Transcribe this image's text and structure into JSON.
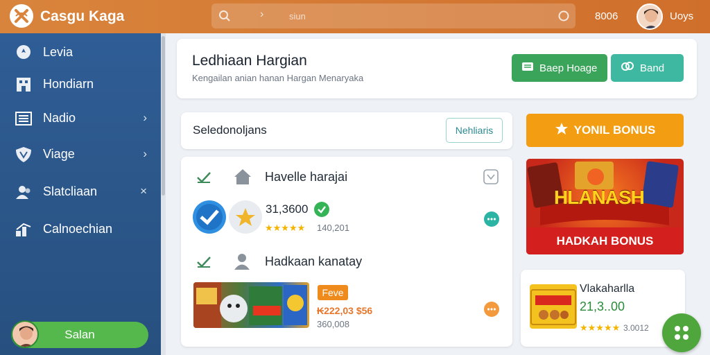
{
  "app": {
    "title": "Casgu Kaga"
  },
  "search": {
    "placeholder": "siun"
  },
  "topbar": {
    "count": "8006",
    "username": "Uoys"
  },
  "sidebar": {
    "items": [
      {
        "label": "Levia",
        "icon": "location-pin-icon",
        "chevron": false
      },
      {
        "label": "Hondiarn",
        "icon": "building-icon",
        "chevron": false
      },
      {
        "label": "Nadio",
        "icon": "list-icon",
        "chevron": true
      },
      {
        "label": "Viage",
        "icon": "shield-icon",
        "chevron": true
      },
      {
        "label": "Slatcliaan",
        "icon": "people-icon",
        "chevron": true
      },
      {
        "label": "Calnoechian",
        "icon": "chart-icon",
        "chevron": false
      }
    ],
    "button_label": "Salan"
  },
  "header": {
    "title": "Ledhiaan Hargian",
    "subtitle": "Kengailan anian hanan Hargan Menaryaka",
    "btn_primary": "Baep Hoage",
    "btn_secondary": "Band"
  },
  "filter": {
    "label": "Seledonoljans",
    "button": "Nehliaris"
  },
  "list": {
    "section1_title": "Havelle harajai",
    "item1": {
      "price": "31,3600",
      "stars": "★★★★★",
      "count": "140,201"
    },
    "section2_title": "Hadkaan kanatay",
    "item2": {
      "badge": "Feve",
      "price": "₭222,03 $56",
      "sub": "360,008"
    }
  },
  "promo": {
    "bar_label": "YONIL BONUS",
    "image_text": "HLANASH",
    "footer_label": "HADKAH BONUS"
  },
  "product": {
    "name": "Vlakaharlla",
    "price": "21,3..00",
    "stars": "★★★★★",
    "count": "3.0012"
  },
  "colors": {
    "topbar": "#d9843c",
    "sidebar": "#2f5d95",
    "primary_green": "#3aa55a",
    "teal": "#3eb8a0",
    "orange": "#f29d12",
    "red": "#d41f1f"
  }
}
